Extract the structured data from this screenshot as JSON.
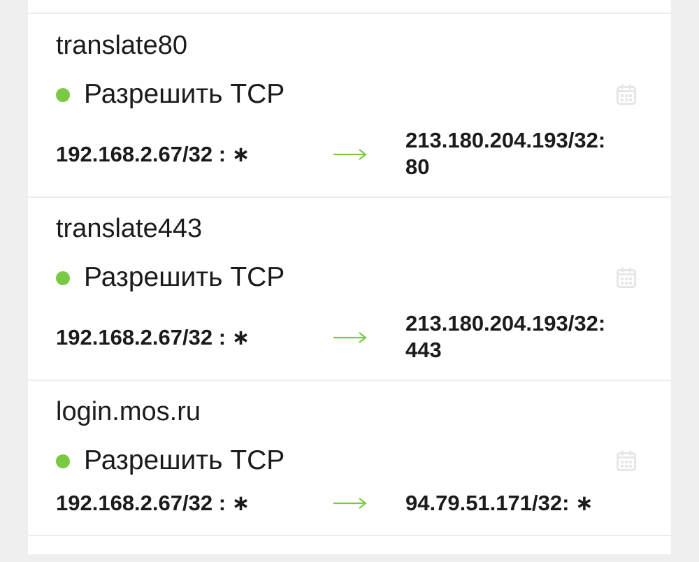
{
  "accent_color": "#7ac943",
  "rules": [
    {
      "name": "translate80",
      "status_color": "#7ac943",
      "action": "Разрешить TCP",
      "schedule_icon": "calendar-icon",
      "source": "192.168.2.67/32 :  ∗",
      "arrow_icon": "arrow-right-icon",
      "destination_line1": "213.180.204.193/32:",
      "destination_line2": "80"
    },
    {
      "name": "translate443",
      "status_color": "#7ac943",
      "action": "Разрешить TCP",
      "schedule_icon": "calendar-icon",
      "source": "192.168.2.67/32 :  ∗",
      "arrow_icon": "arrow-right-icon",
      "destination_line1": "213.180.204.193/32:",
      "destination_line2": "443"
    },
    {
      "name": "login.mos.ru",
      "status_color": "#7ac943",
      "action": "Разрешить TCP",
      "schedule_icon": "calendar-icon",
      "source": "192.168.2.67/32 :  ∗",
      "arrow_icon": "arrow-right-icon",
      "destination_line1": "94.79.51.171/32:  ∗",
      "destination_line2": ""
    }
  ]
}
